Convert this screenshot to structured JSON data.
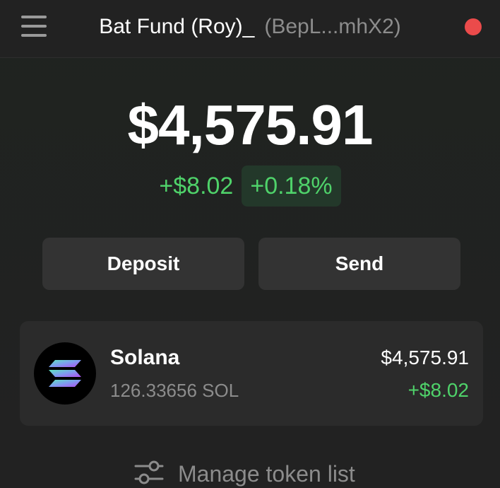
{
  "header": {
    "menu_icon": "hamburger-menu-icon",
    "wallet_name": "Bat Fund (Roy)_",
    "wallet_address": "(BepL...mhX2)",
    "status_color": "#eb4b4b"
  },
  "portfolio": {
    "balance": "$4,575.91",
    "change_amount": "+$8.02",
    "change_percent": "+0.18%",
    "positive_color": "#4fd26a"
  },
  "actions": {
    "deposit_label": "Deposit",
    "send_label": "Send"
  },
  "tokens": [
    {
      "icon": "solana-logo-icon",
      "name": "Solana",
      "amount": "126.33656 SOL",
      "value": "$4,575.91",
      "change": "+$8.02"
    }
  ],
  "manage": {
    "icon": "sliders-icon",
    "label": "Manage token list"
  }
}
